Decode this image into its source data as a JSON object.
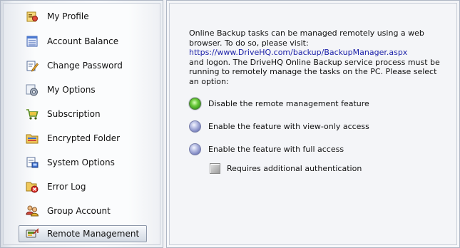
{
  "sidebar": {
    "items": [
      {
        "label": "My Profile",
        "icon": "profile-icon"
      },
      {
        "label": "Account Balance",
        "icon": "ledger-icon"
      },
      {
        "label": "Change Password",
        "icon": "pencil-icon"
      },
      {
        "label": "My Options",
        "icon": "gear-icon"
      },
      {
        "label": "Subscription",
        "icon": "cart-icon"
      },
      {
        "label": "Encrypted Folder",
        "icon": "folder-lock-icon"
      },
      {
        "label": "System Options",
        "icon": "system-icon"
      },
      {
        "label": "Error Log",
        "icon": "error-log-icon"
      },
      {
        "label": "Group Account",
        "icon": "group-icon"
      },
      {
        "label": "Remote Management",
        "icon": "remote-icon"
      }
    ],
    "active_item": "Remote Management"
  },
  "main": {
    "description_line1": "Online Backup tasks can be managed remotely using a web browser. To do so, please visit:",
    "link": "https://www.DriveHQ.com/backup/BackupManager.aspx",
    "description_line2": "and logon. The DriveHQ Online Backup service process must be running to remotely manage the tasks on the PC. Please select an option:",
    "options": [
      {
        "label": "Disable the remote management feature",
        "selected": true
      },
      {
        "label": "Enable the feature with view-only access",
        "selected": false
      },
      {
        "label": "Enable the feature with full access",
        "selected": false
      }
    ],
    "checkbox": {
      "label": "Requires additional authentication",
      "checked": false,
      "enabled": false
    }
  },
  "colors": {
    "link": "#1a1fa8",
    "selected_radio": "#3fa524",
    "unselected_radio": "#6f78b8"
  }
}
